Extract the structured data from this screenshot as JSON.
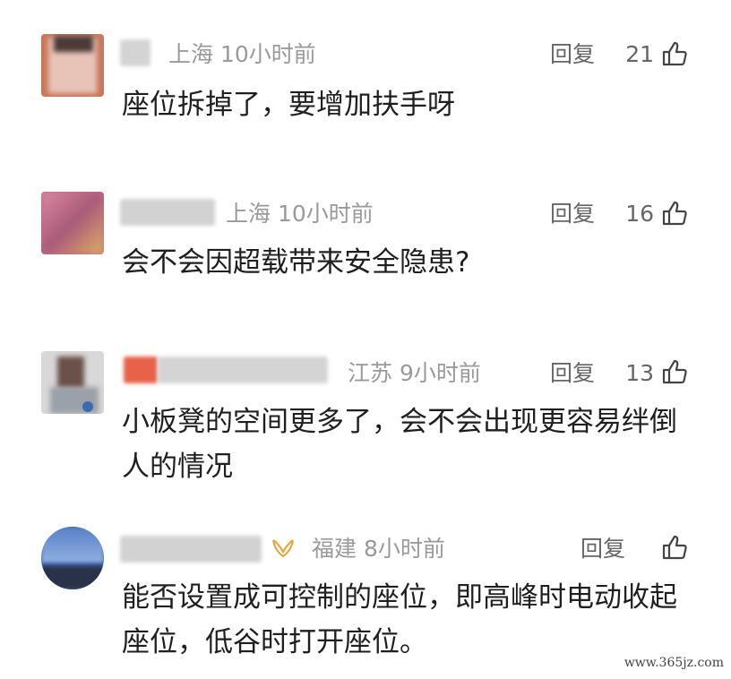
{
  "comments": [
    {
      "location": "上海",
      "time": "10小时前",
      "reply_label": "回复",
      "likes": "21",
      "text": "座位拆掉了，要增加扶手呀"
    },
    {
      "location": "上海",
      "time": "10小时前",
      "reply_label": "回复",
      "likes": "16",
      "text": "会不会因超载带来安全隐患?"
    },
    {
      "location": "江苏",
      "time": "9小时前",
      "reply_label": "回复",
      "likes": "13",
      "text": "小板凳的空间更多了，会不会出现更容易绊倒人的情况"
    },
    {
      "location": "福建",
      "time": "8小时前",
      "reply_label": "回复",
      "likes": "",
      "text": "能否设置成可控制的座位，即高峰时电动收起座位，低谷时打开座位。"
    }
  ],
  "watermark": "www.365jz.com",
  "colors": {
    "meta": "#9a9a9a",
    "text": "#1f1f1f",
    "badge": "#f0a030"
  }
}
